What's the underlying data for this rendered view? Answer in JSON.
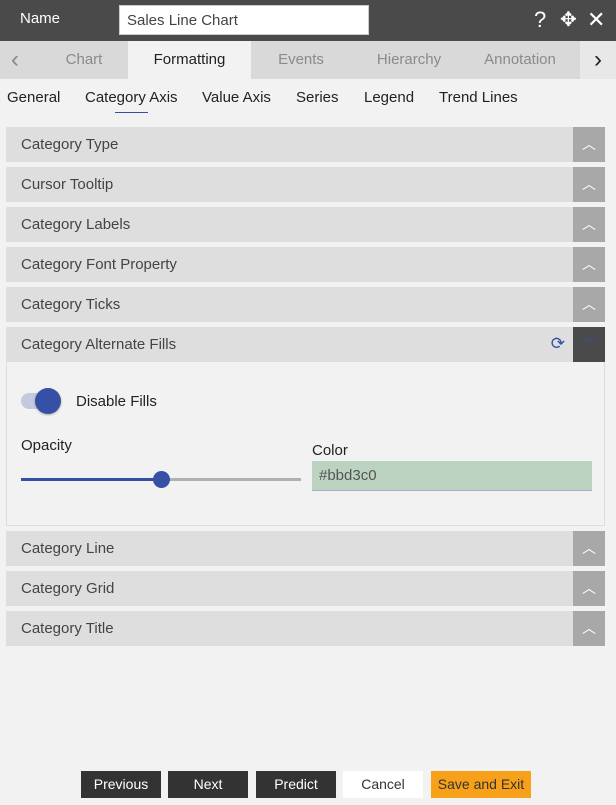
{
  "header": {
    "name_label": "Name",
    "name_value": "Sales Line Chart"
  },
  "tabs": [
    "Chart",
    "Formatting",
    "Events",
    "Hierarchy",
    "Annotation"
  ],
  "active_tab": "Formatting",
  "subtabs": [
    "General",
    "Category Axis",
    "Value Axis",
    "Series",
    "Legend",
    "Trend Lines"
  ],
  "active_subtab": "Category Axis",
  "panels_top": [
    "Category Type",
    "Cursor Tooltip",
    "Category Labels",
    "Category Font Property",
    "Category Ticks"
  ],
  "open_panel": {
    "title": "Category Alternate Fills",
    "toggle_label": "Disable Fills",
    "toggle_on": true,
    "opacity_label": "Opacity",
    "opacity_value": 0.5,
    "color_label": "Color",
    "color_value": "#bbd3c0"
  },
  "panels_bottom": [
    "Category Line",
    "Category Grid",
    "Category Title"
  ],
  "footer": {
    "previous": "Previous",
    "next": "Next",
    "predict": "Predict",
    "cancel": "Cancel",
    "save": "Save and Exit"
  },
  "colors": {
    "accent": "#3550a5",
    "save": "#f7a11a",
    "header": "#4a4a4a"
  }
}
